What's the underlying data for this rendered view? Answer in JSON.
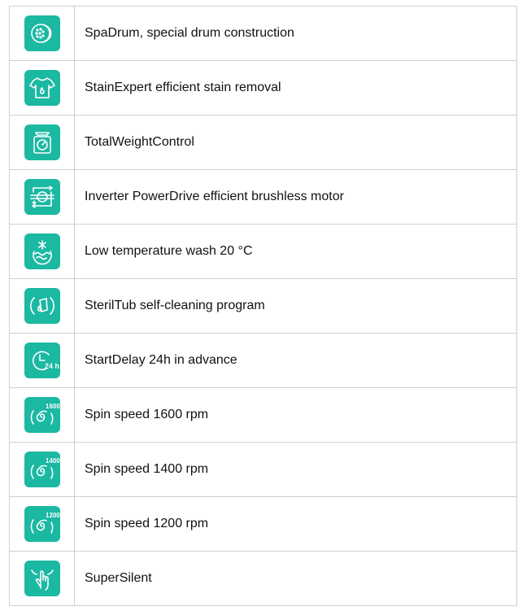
{
  "features": [
    {
      "icon": "spadrum-icon",
      "label": "SpaDrum, special drum construction"
    },
    {
      "icon": "shirt-stain-icon",
      "label": "StainExpert efficient stain removal"
    },
    {
      "icon": "scale-icon",
      "label": "TotalWeightControl"
    },
    {
      "icon": "inverter-motor-icon",
      "label": "Inverter PowerDrive efficient brushless motor"
    },
    {
      "icon": "low-temperature-icon",
      "label": "Low temperature wash 20 °C"
    },
    {
      "icon": "steriltub-icon",
      "label": "SterilTub self-cleaning program"
    },
    {
      "icon": "start-delay-icon",
      "label": "StartDelay 24h in advance",
      "badge": "24 h"
    },
    {
      "icon": "spin-speed-icon",
      "label": "Spin speed 1600 rpm",
      "badge": "1600"
    },
    {
      "icon": "spin-speed-icon",
      "label": "Spin speed 1400 rpm",
      "badge": "1400"
    },
    {
      "icon": "spin-speed-icon",
      "label": "Spin speed 1200 rpm",
      "badge": "1200"
    },
    {
      "icon": "supersilent-icon",
      "label": "SuperSilent"
    }
  ],
  "colors": {
    "icon_background": "#1bb8a2",
    "icon_foreground": "#ffffff",
    "border": "#cfcfcf",
    "text": "#111111"
  }
}
